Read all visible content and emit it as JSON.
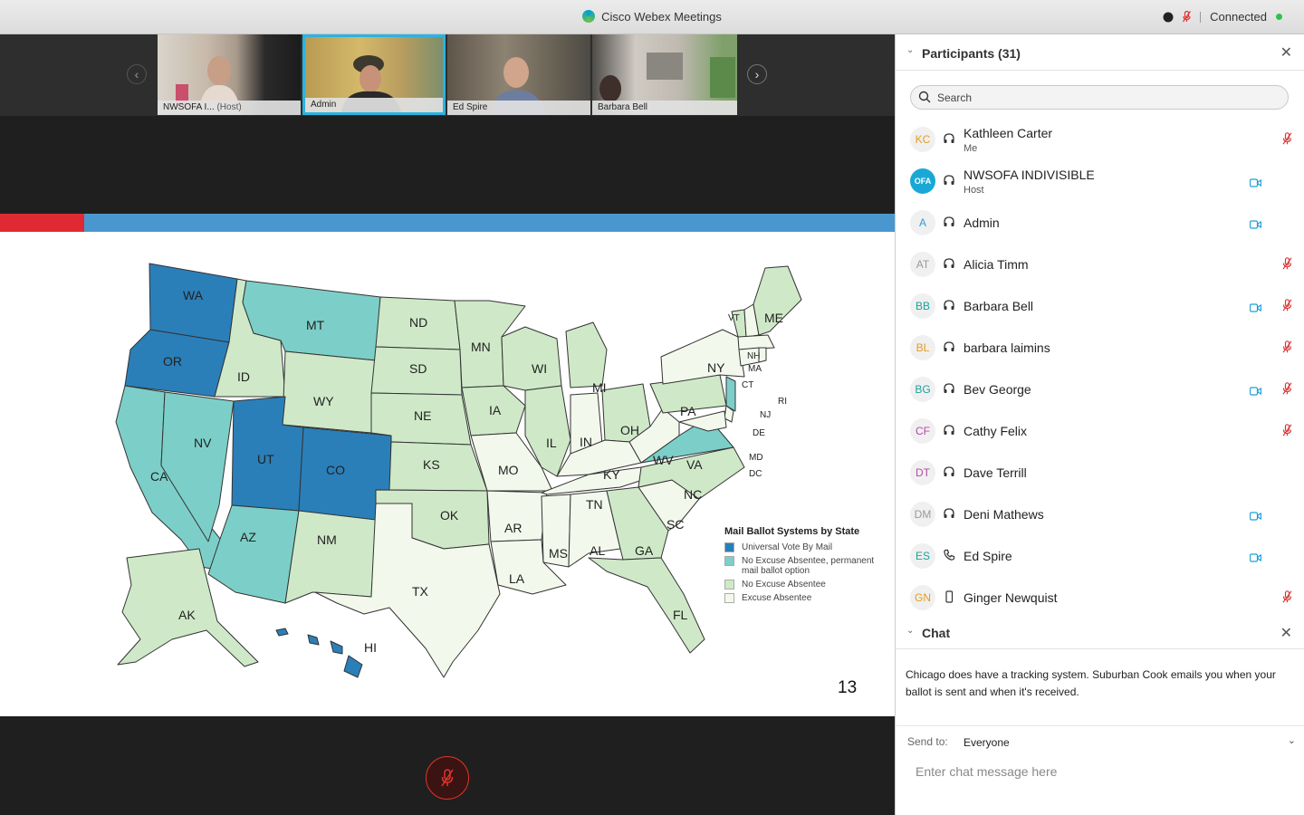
{
  "titlebar": {
    "title": "Cisco Webex Meetings",
    "status": "Connected"
  },
  "thumbnails": [
    {
      "name": "NWSOFA I...",
      "suffix": "(Host)"
    },
    {
      "name": "Admin",
      "suffix": ""
    },
    {
      "name": "Ed Spire",
      "suffix": ""
    },
    {
      "name": "Barbara Bell",
      "suffix": ""
    }
  ],
  "slide": {
    "page_number": "13",
    "legend": {
      "title": "Mail Ballot Systems by State",
      "items": [
        {
          "label": "Universal Vote By Mail",
          "color": "#2a7fb9"
        },
        {
          "label": "No Excuse Absentee, permanent mail ballot option",
          "color": "#7ccfc8"
        },
        {
          "label": "No Excuse Absentee",
          "color": "#cfe9c8"
        },
        {
          "label": "Excuse Absentee",
          "color": "#f3f8ec"
        }
      ]
    },
    "states": {
      "WA": "WA",
      "OR": "OR",
      "CA": "CA",
      "NV": "NV",
      "ID": "ID",
      "MT": "MT",
      "WY": "WY",
      "UT": "UT",
      "CO": "CO",
      "AZ": "AZ",
      "NM": "NM",
      "ND": "ND",
      "SD": "SD",
      "NE": "NE",
      "KS": "KS",
      "OK": "OK",
      "TX": "TX",
      "MN": "MN",
      "IA": "IA",
      "MO": "MO",
      "AR": "AR",
      "LA": "LA",
      "WI": "WI",
      "IL": "IL",
      "MI": "MI",
      "IN": "IN",
      "OH": "OH",
      "KY": "KY",
      "TN": "TN",
      "MS": "MS",
      "AL": "AL",
      "GA": "GA",
      "FL": "FL",
      "SC": "SC",
      "NC": "NC",
      "VA": "VA",
      "WV": "WV",
      "PA": "PA",
      "NY": "NY",
      "VT": "VT",
      "NH": "NH",
      "ME": "ME",
      "MA": "MA",
      "CT": "CT",
      "RI": "RI",
      "NJ": "NJ",
      "DE": "DE",
      "MD": "MD",
      "DC": "DC",
      "AK": "AK",
      "HI": "HI"
    }
  },
  "participants": {
    "title": "Participants (31)",
    "search_placeholder": "Search",
    "list": [
      {
        "initials": "KC",
        "name": "Kathleen Carter",
        "role": "Me",
        "color": "#e89b1c",
        "video": false,
        "muted": true
      },
      {
        "initials": "OFA",
        "name": "NWSOFA INDIVISIBLE",
        "role": "Host",
        "color": "#ffffff",
        "video": true,
        "muted": false
      },
      {
        "initials": "A",
        "name": "Admin",
        "role": "",
        "color": "#2a9fd6",
        "video": true,
        "muted": false
      },
      {
        "initials": "AT",
        "name": "Alicia Timm",
        "role": "",
        "color": "#999999",
        "video": false,
        "muted": true
      },
      {
        "initials": "BB",
        "name": "Barbara Bell",
        "role": "",
        "color": "#1aa39c",
        "video": true,
        "muted": true
      },
      {
        "initials": "BL",
        "name": "barbara laimins",
        "role": "",
        "color": "#e89b1c",
        "video": false,
        "muted": true
      },
      {
        "initials": "BG",
        "name": "Bev George",
        "role": "",
        "color": "#1aa39c",
        "video": true,
        "muted": true
      },
      {
        "initials": "CF",
        "name": "Cathy Felix",
        "role": "",
        "color": "#b54aa6",
        "video": false,
        "muted": true
      },
      {
        "initials": "DT",
        "name": "Dave Terrill",
        "role": "",
        "color": "#b54aa6",
        "video": false,
        "muted": false
      },
      {
        "initials": "DM",
        "name": "Deni Mathews",
        "role": "",
        "color": "#999999",
        "video": true,
        "muted": false
      },
      {
        "initials": "ES",
        "name": "Ed Spire",
        "role": "",
        "color": "#1aa39c",
        "video": true,
        "muted": false
      },
      {
        "initials": "GN",
        "name": "Ginger Newquist",
        "role": "",
        "color": "#e89b1c",
        "video": false,
        "muted": true
      }
    ]
  },
  "chat": {
    "title": "Chat",
    "message": "Chicago does have a tracking system. Suburban Cook emails you when your ballot is sent and when it's received.",
    "send_to_label": "Send to:",
    "send_to_value": "Everyone",
    "input_placeholder": "Enter chat message here"
  }
}
